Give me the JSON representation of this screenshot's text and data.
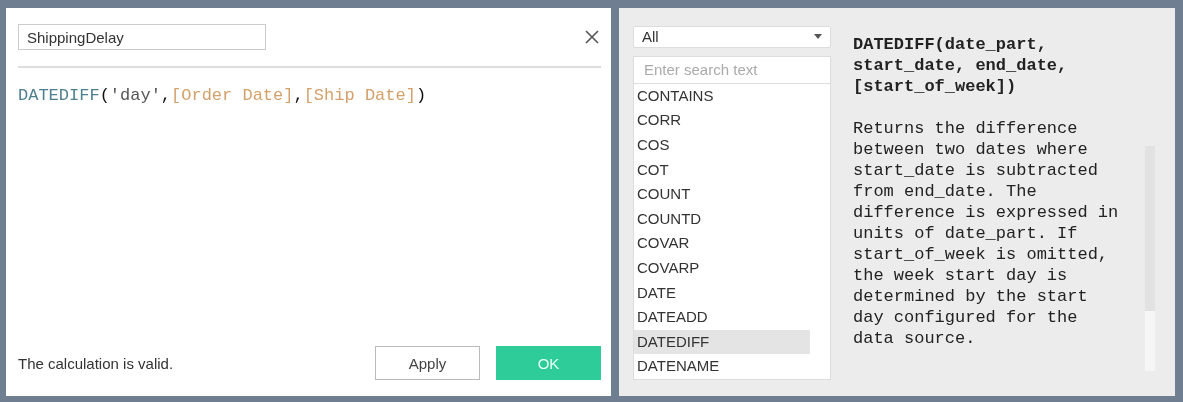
{
  "calc_name": {
    "value": "ShippingDelay"
  },
  "formula": [
    {
      "kind": "function",
      "text": "DATEDIFF"
    },
    {
      "kind": "punct",
      "text": "("
    },
    {
      "kind": "string",
      "text": "'day'"
    },
    {
      "kind": "punct",
      "text": ","
    },
    {
      "kind": "field",
      "text": "[Order Date]"
    },
    {
      "kind": "punct",
      "text": ","
    },
    {
      "kind": "field",
      "text": "[Ship Date]"
    },
    {
      "kind": "punct",
      "text": ")"
    }
  ],
  "status": "The calculation is valid.",
  "buttons": [
    {
      "kind": "secondary",
      "label": "Apply"
    },
    {
      "kind": "primary",
      "label": "OK"
    }
  ],
  "category_dropdown": {
    "value": "All"
  },
  "search": {
    "placeholder": "Enter search text"
  },
  "functions": [
    {
      "name": "CONTAINS",
      "selected": false
    },
    {
      "name": "CORR",
      "selected": false
    },
    {
      "name": "COS",
      "selected": false
    },
    {
      "name": "COT",
      "selected": false
    },
    {
      "name": "COUNT",
      "selected": false
    },
    {
      "name": "COUNTD",
      "selected": false
    },
    {
      "name": "COVAR",
      "selected": false
    },
    {
      "name": "COVARP",
      "selected": false
    },
    {
      "name": "DATE",
      "selected": false
    },
    {
      "name": "DATEADD",
      "selected": false
    },
    {
      "name": "DATEDIFF",
      "selected": true
    },
    {
      "name": "DATENAME",
      "selected": false
    }
  ],
  "help": {
    "signature": "DATEDIFF(date_part, start_date, end_date, [start_of_week])",
    "description": "Returns the difference between two dates where start_date is subtracted from end_date. The difference is expressed in units of date_part. If start_of_week is omitted, the week start day is determined by the start day configured for the data source."
  }
}
